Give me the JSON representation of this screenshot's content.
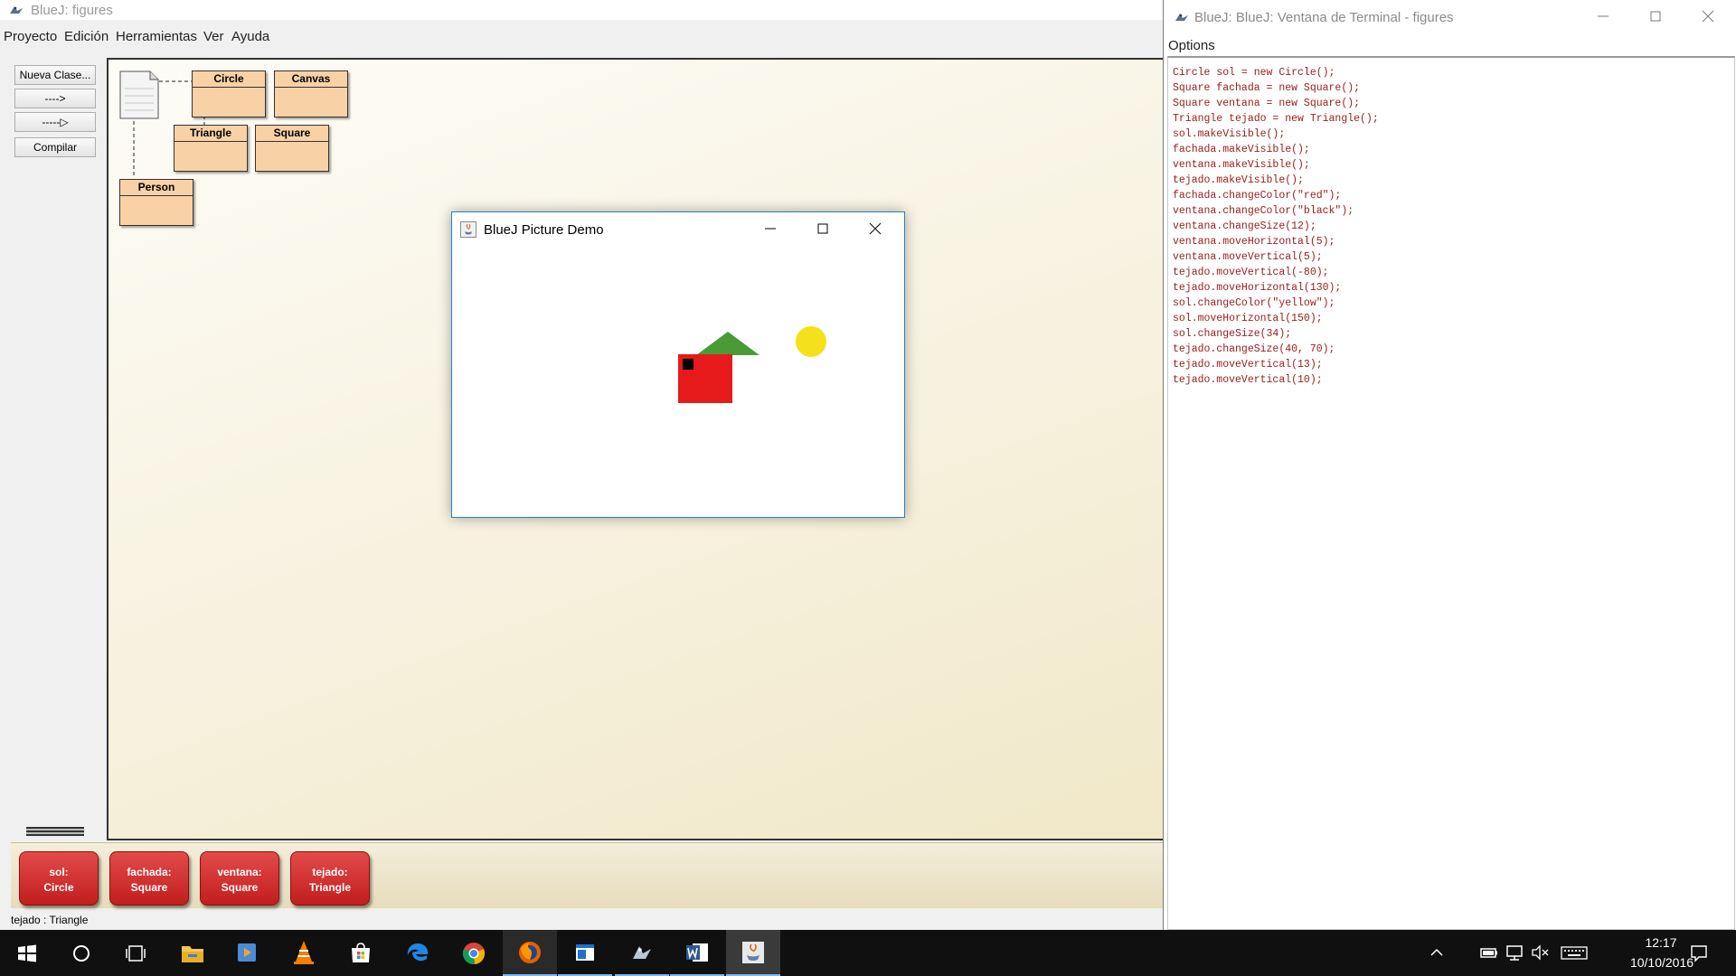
{
  "main_window": {
    "title": "BlueJ:  figures",
    "menu": [
      "Proyecto",
      "Edición",
      "Herramientas",
      "Ver",
      "Ayuda"
    ],
    "toolbar": {
      "new_class": "Nueva Clase...",
      "uses_arrow": "---->",
      "inherits_arrow": "-----▷",
      "compile": "Compilar"
    },
    "classes": [
      "Circle",
      "Canvas",
      "Triangle",
      "Square",
      "Person"
    ],
    "objects": [
      {
        "name": "sol:",
        "type": "Circle"
      },
      {
        "name": "fachada:",
        "type": "Square"
      },
      {
        "name": "ventana:",
        "type": "Square"
      },
      {
        "name": "tejado:",
        "type": "Triangle"
      }
    ],
    "status": "tejado : Triangle"
  },
  "picture_window": {
    "title": "BlueJ Picture Demo",
    "colors": {
      "roof": "#4a9b38",
      "wall": "#e61a1a",
      "window": "#000000",
      "sun": "#f5e11a"
    }
  },
  "terminal": {
    "title": "BlueJ: BlueJ:  Ventana de Terminal - figures",
    "menu": "Options",
    "lines": [
      "Circle sol = new Circle();",
      "Square fachada = new Square();",
      "Square ventana = new Square();",
      "Triangle tejado = new Triangle();",
      "sol.makeVisible();",
      "fachada.makeVisible();",
      "ventana.makeVisible();",
      "tejado.makeVisible();",
      "fachada.changeColor(\"red\");",
      "ventana.changeColor(\"black\");",
      "ventana.changeSize(12);",
      "ventana.moveHorizontal(5);",
      "ventana.moveVertical(5);",
      "tejado.moveVertical(-80);",
      "tejado.moveHorizontal(130);",
      "sol.changeColor(\"yellow\");",
      "sol.moveHorizontal(150);",
      "sol.changeSize(34);",
      "tejado.changeSize(40, 70);",
      "tejado.moveVertical(13);",
      "tejado.moveVertical(10);"
    ]
  },
  "taskbar": {
    "apps": [
      "start-icon",
      "cortana-icon",
      "task-view-icon",
      "file-explorer-icon",
      "media-player-icon",
      "vlc-icon",
      "store-icon",
      "edge-icon",
      "chrome-icon",
      "firefox-icon",
      "calculator-window-icon",
      "bluej-icon",
      "word-icon",
      "java-icon"
    ],
    "time": "12:17",
    "date": "10/10/2016"
  }
}
